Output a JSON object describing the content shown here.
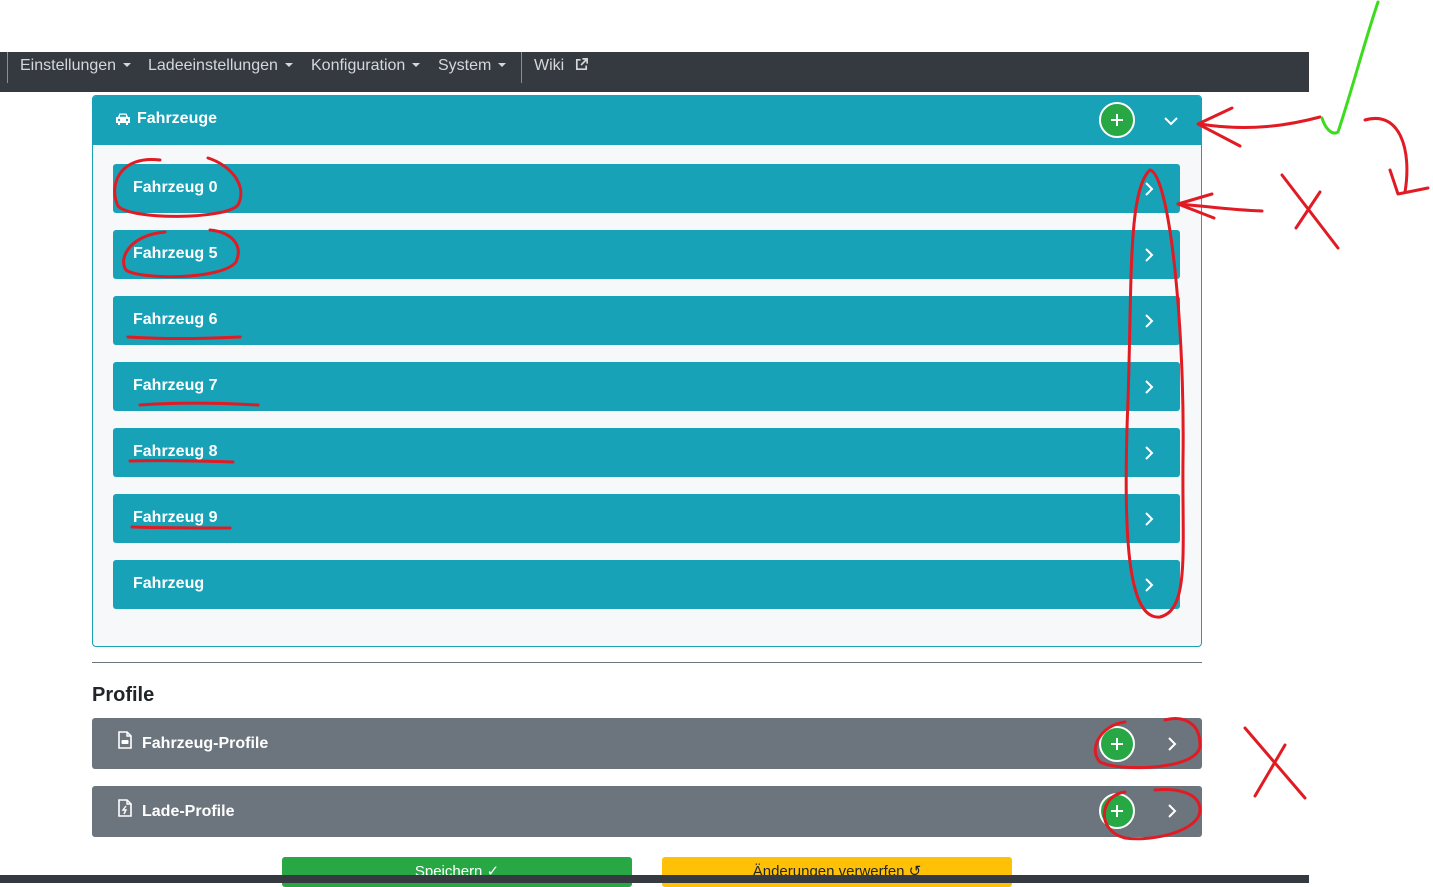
{
  "nav": {
    "items": [
      {
        "label": "Einstellungen"
      },
      {
        "label": "Ladeeinstellungen"
      },
      {
        "label": "Konfiguration"
      },
      {
        "label": "System"
      }
    ],
    "wiki_label": "Wiki"
  },
  "vehicles": {
    "title": "Fahrzeuge",
    "items": [
      {
        "label": "Fahrzeug 0"
      },
      {
        "label": "Fahrzeug 5"
      },
      {
        "label": "Fahrzeug 6"
      },
      {
        "label": "Fahrzeug 7"
      },
      {
        "label": "Fahrzeug 8"
      },
      {
        "label": "Fahrzeug 9"
      },
      {
        "label": "Fahrzeug"
      }
    ]
  },
  "profiles": {
    "title": "Profile",
    "items": [
      {
        "label": "Fahrzeug-Profile",
        "icon": "vehicle-profile-icon"
      },
      {
        "label": "Lade-Profile",
        "icon": "charge-profile-icon"
      }
    ]
  },
  "footer": {
    "save_label": "Speichern ✓",
    "discard_label": "Änderungen verwerfen ↺"
  },
  "colors": {
    "info": "#17a2b8",
    "success": "#28a745",
    "secondary": "#6c757d",
    "warning": "#ffc107",
    "navbar": "#343a40",
    "annotation_red": "#e01b24",
    "annotation_green": "#3bdc1e"
  }
}
